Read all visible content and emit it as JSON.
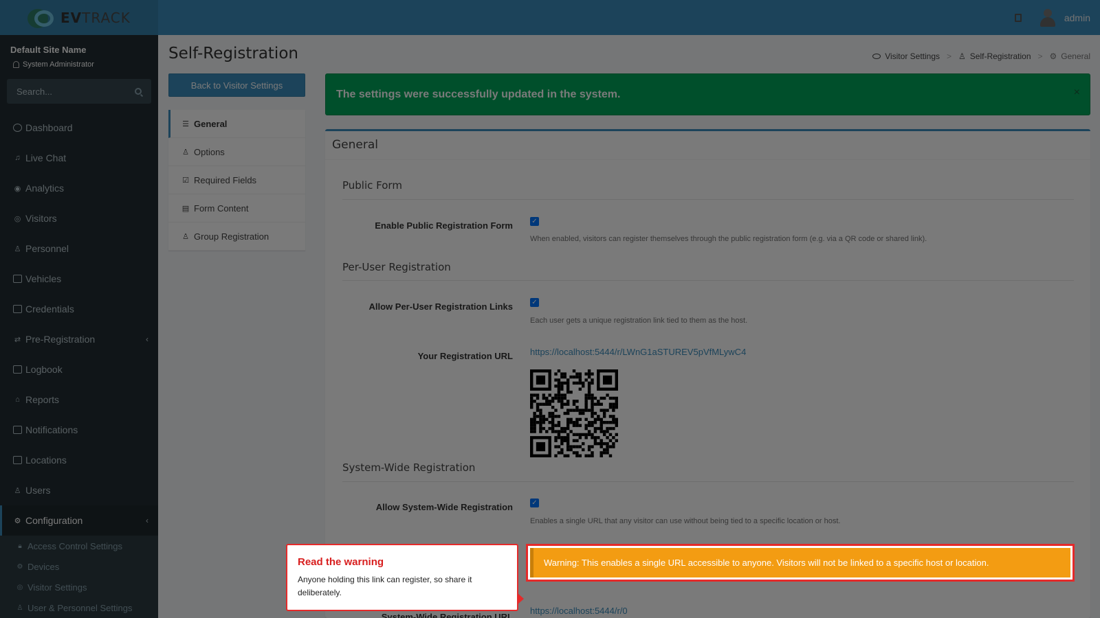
{
  "brand": {
    "prefix": "EV",
    "suffix": "TRACK",
    "logo_icon": "evtrack-logo"
  },
  "topbar": {
    "user_name": "admin",
    "door_icon": "door-icon",
    "avatar_icon": "user-avatar"
  },
  "sidebar": {
    "site_name": "Default Site Name",
    "role": "System Administrator",
    "search_placeholder": "Search...",
    "items": [
      {
        "label": "Dashboard",
        "icon": "dashboard-icon"
      },
      {
        "label": "Live Chat",
        "icon": "headset-icon"
      },
      {
        "label": "Analytics",
        "icon": "analytics-icon"
      },
      {
        "label": "Visitors",
        "icon": "eye-icon"
      },
      {
        "label": "Personnel",
        "icon": "personnel-icon"
      },
      {
        "label": "Vehicles",
        "icon": "car-icon"
      },
      {
        "label": "Credentials",
        "icon": "credentials-icon"
      },
      {
        "label": "Pre-Registration",
        "icon": "exchange-icon",
        "caret": "‹"
      },
      {
        "label": "Logbook",
        "icon": "book-icon"
      },
      {
        "label": "Reports",
        "icon": "reports-icon"
      },
      {
        "label": "Notifications",
        "icon": "chat-icon"
      },
      {
        "label": "Locations",
        "icon": "building-icon"
      },
      {
        "label": "Users",
        "icon": "users-icon"
      },
      {
        "label": "Configuration",
        "icon": "gear-icon",
        "caret": "‹"
      }
    ],
    "sub_items": [
      {
        "label": "Access Control Settings",
        "icon": "lock-icon"
      },
      {
        "label": "Devices",
        "icon": "devices-icon"
      },
      {
        "label": "Visitor Settings",
        "icon": "eye-icon"
      },
      {
        "label": "User & Personnel Settings",
        "icon": "users-icon"
      }
    ]
  },
  "page": {
    "title": "Self-Registration",
    "breadcrumb": [
      "Visitor Settings",
      "Self-Registration",
      "General"
    ],
    "back_button": "Back to Visitor Settings"
  },
  "subnav": [
    {
      "label": "General",
      "icon": "sliders-icon"
    },
    {
      "label": "Options",
      "icon": "user-gear-icon"
    },
    {
      "label": "Required Fields",
      "icon": "checklist-icon"
    },
    {
      "label": "Form Content",
      "icon": "form-icon"
    },
    {
      "label": "Group Registration",
      "icon": "group-icon"
    }
  ],
  "alert": {
    "message": "The settings were successfully updated in the system.",
    "close": "×"
  },
  "panel": {
    "title": "General",
    "public_form": {
      "heading": "Public Form",
      "label": "Enable Public Registration Form",
      "checked": true,
      "help": "When enabled, visitors can register themselves through the public registration form (e.g. via a QR code or shared link)."
    },
    "per_user": {
      "heading": "Per-User Registration",
      "label": "Allow Per-User Registration Links",
      "checked": true,
      "help": "Each user gets a unique registration link tied to them as the host.",
      "url_label": "Your Registration URL",
      "url": "https://localhost:5444/r/LWnG1aSTUREV5pVfMLywC4"
    },
    "system_wide": {
      "heading": "System-Wide Registration",
      "label": "Allow System-Wide Registration",
      "checked": true,
      "help": "Enables a single URL that any visitor can use without being tied to a specific location or host.",
      "warning": "Warning: This enables a single URL accessible to anyone. Visitors will not be linked to a specific host or location.",
      "url_label": "System-Wide Registration URL",
      "url": "https://localhost:5444/r/0"
    }
  },
  "tooltip": {
    "title": "Read the warning",
    "body": "Anyone holding this link can register, so share it deliberately."
  },
  "colors": {
    "navbar": "#3c8dbc",
    "sidebar": "#222d32",
    "success": "#00a65a",
    "warning": "#f39c12",
    "highlight": "#e52a2a"
  }
}
